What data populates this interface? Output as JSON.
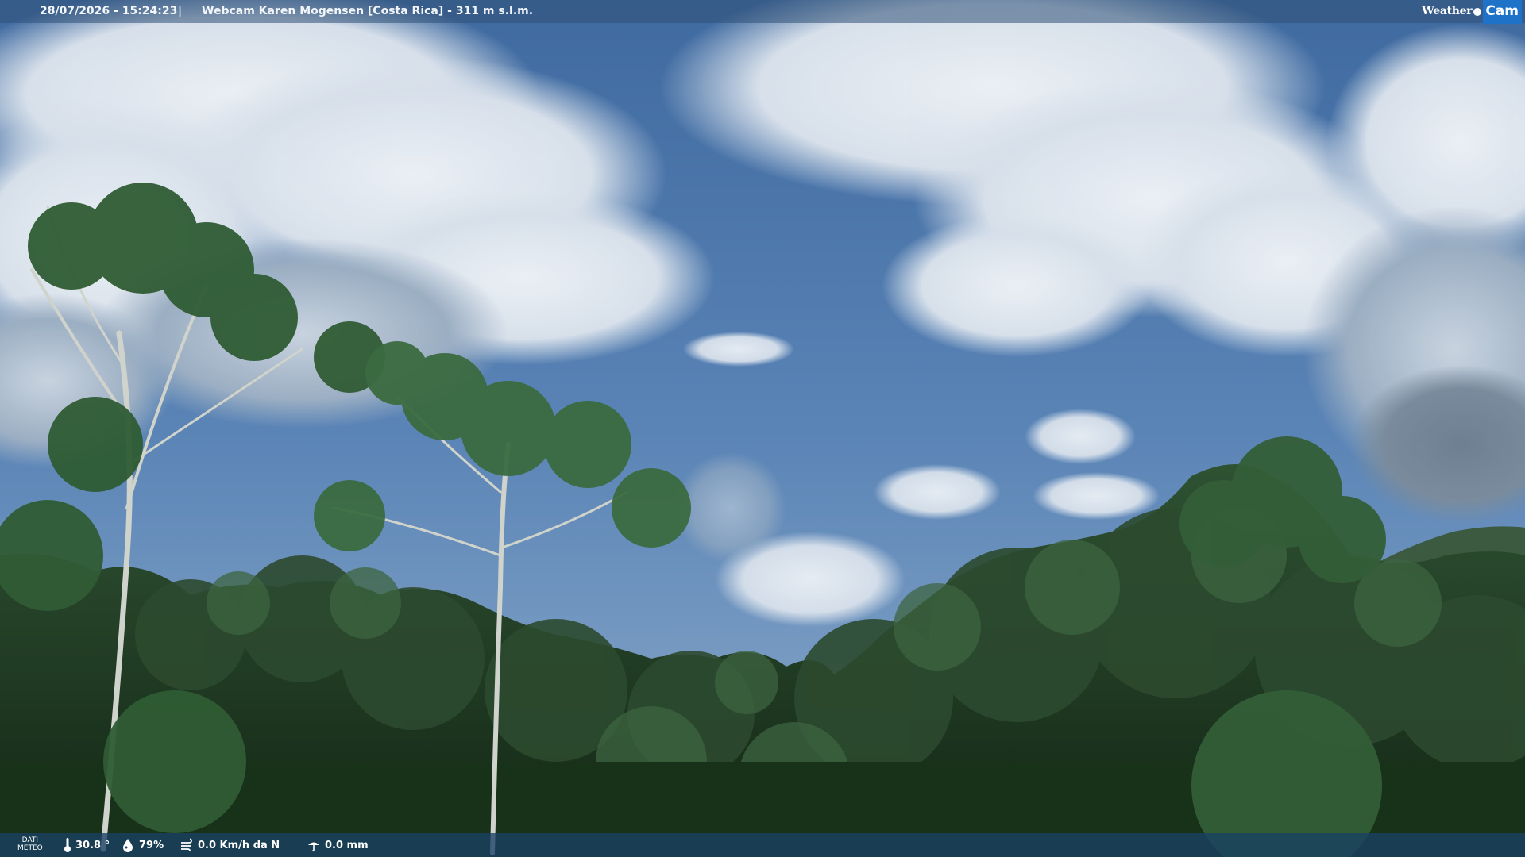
{
  "overlay": {
    "datetime": "28/07/2026 - 15:24:23",
    "separator": "|",
    "caption": "Webcam Karen Mogensen [Costa Rica]  - 311 m s.l.m."
  },
  "brand": {
    "weather": "Weather",
    "cam": "Cam"
  },
  "meteo": {
    "label_line1": "DATI",
    "label_line2": "METEO",
    "temperature": "30.8 °",
    "humidity": "79%",
    "wind": "0.0 Km/h da N",
    "rain": "0.0 mm"
  },
  "icons": [
    "thermometer-icon",
    "humidity-icon",
    "wind-icon",
    "rain-icon"
  ],
  "colors": {
    "sky": "#4d78a8",
    "cloud": "#e6ecf2",
    "foliage": "#1f3a22",
    "topbar": "#305076",
    "bottombar": "#1a4064",
    "brand_accent": "#1e73c8"
  }
}
